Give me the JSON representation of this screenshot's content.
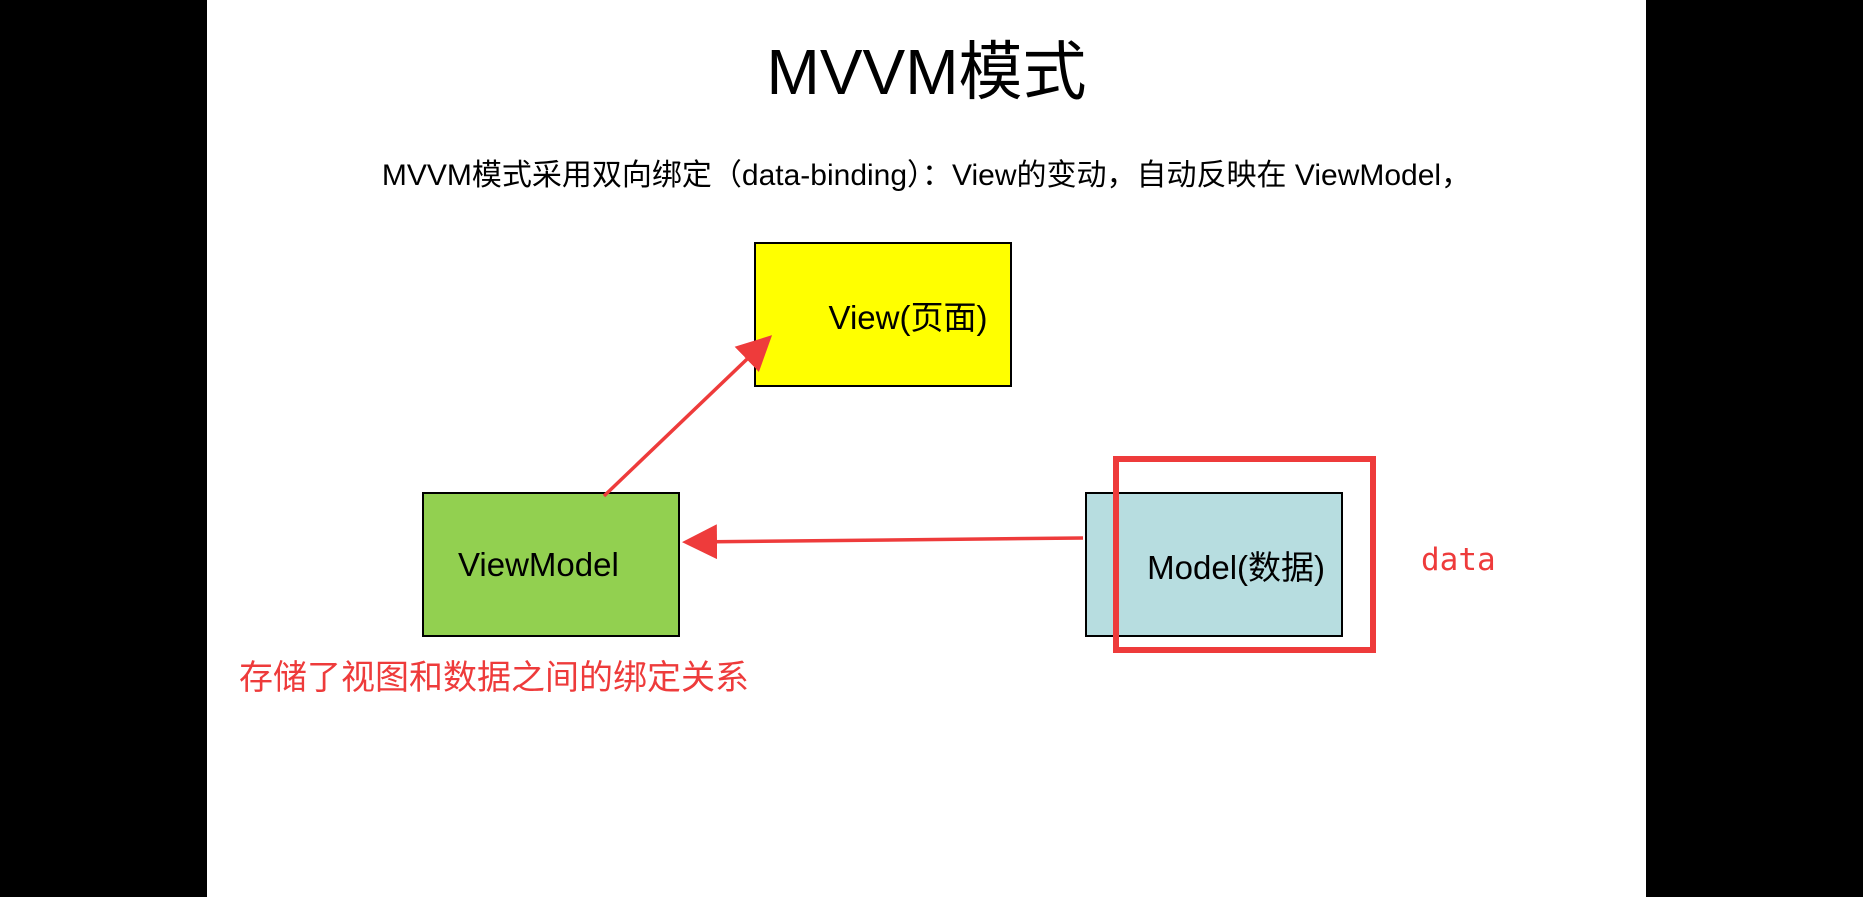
{
  "slide": {
    "title": "MVVM模式",
    "subtitle": "MVVM模式采用双向绑定（data-binding）：View的变动，自动反映在 ViewModel，"
  },
  "diagram": {
    "nodes": {
      "view": {
        "label": "View(页面)",
        "fill": "#ffff00"
      },
      "viewmodel": {
        "label": "ViewModel",
        "fill": "#92d050"
      },
      "model": {
        "label": "Model(数据)",
        "fill": "#b7dde0"
      }
    },
    "edges": [
      {
        "from": "viewmodel",
        "to": "view",
        "color": "#ee3b3b"
      },
      {
        "from": "model",
        "to": "viewmodel",
        "color": "#ee3b3b"
      }
    ],
    "annotations": {
      "data_label": "data",
      "binding_note": "存储了视图和数据之间的绑定关系",
      "color": "#ee3b3b"
    }
  }
}
